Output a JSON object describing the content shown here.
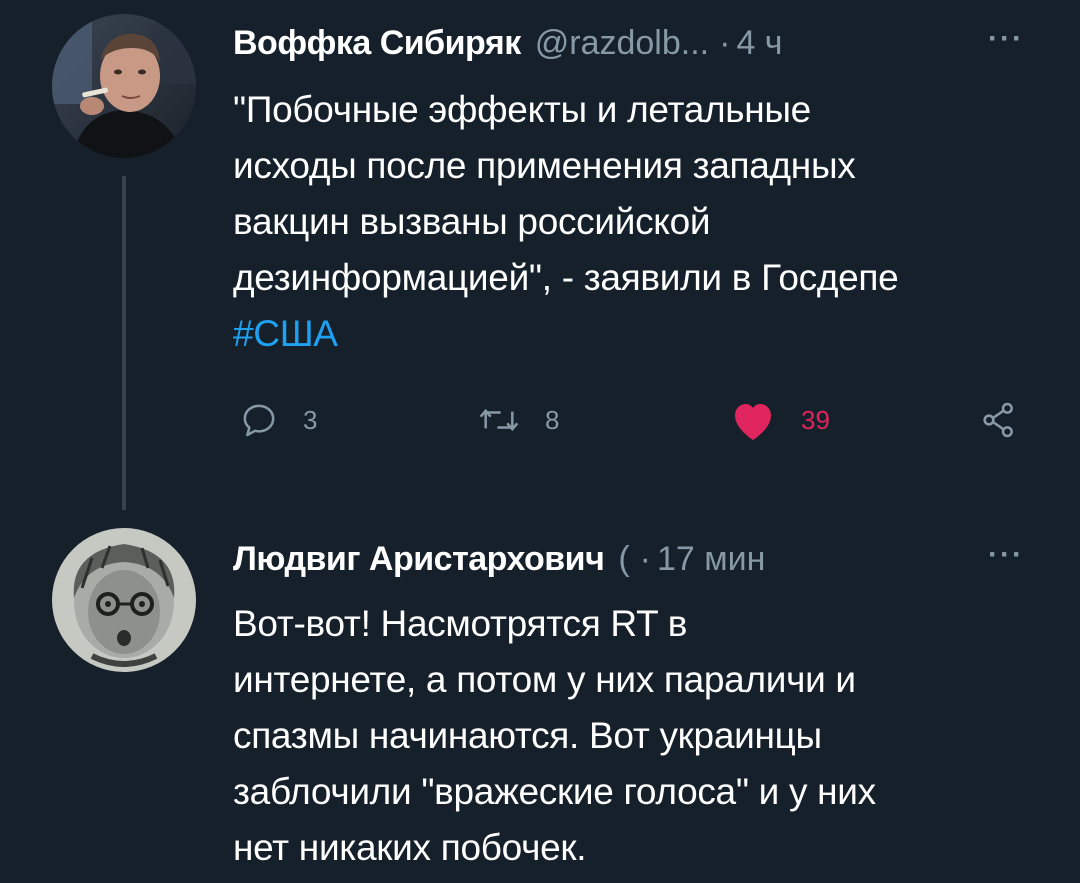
{
  "tweets": [
    {
      "author": {
        "name": "Воффка Сибиряк",
        "handle": "@razdolb...",
        "avatar": "man-photo-avatar"
      },
      "separator": "·",
      "time": "4 ч",
      "more": "···",
      "text_lines": [
        "\"Побочные эффекты и летальные",
        "исходы после применения западных",
        "вакцин вызваны российской",
        "дезинформацией\", - заявили в Госдепе"
      ],
      "hashtag": "#США",
      "actions": {
        "reply": {
          "icon": "reply-icon",
          "count": "3"
        },
        "retweet": {
          "icon": "retweet-icon",
          "count": "8"
        },
        "like": {
          "icon": "heart-filled-icon",
          "count": "39",
          "color": "#e0245e"
        },
        "share": {
          "icon": "share-icon"
        }
      }
    },
    {
      "author": {
        "name": "Людвиг Аристархович",
        "handle": "(",
        "avatar": "sketch-portrait-avatar"
      },
      "separator": "·",
      "time": "17 мин",
      "more": "···",
      "text_lines": [
        "Вот-вот! Насмотрятся RT в",
        "интернете, а потом у них параличи и",
        "спазмы начинаются. Вот украинцы",
        "заблочили \"вражеские голоса\" и у них",
        "нет никаких побочек."
      ]
    }
  ],
  "colors": {
    "background": "#15202b",
    "secondary_text": "#8899a6",
    "link": "#1da1f2",
    "like": "#e0245e",
    "thread_line": "#38444d"
  }
}
